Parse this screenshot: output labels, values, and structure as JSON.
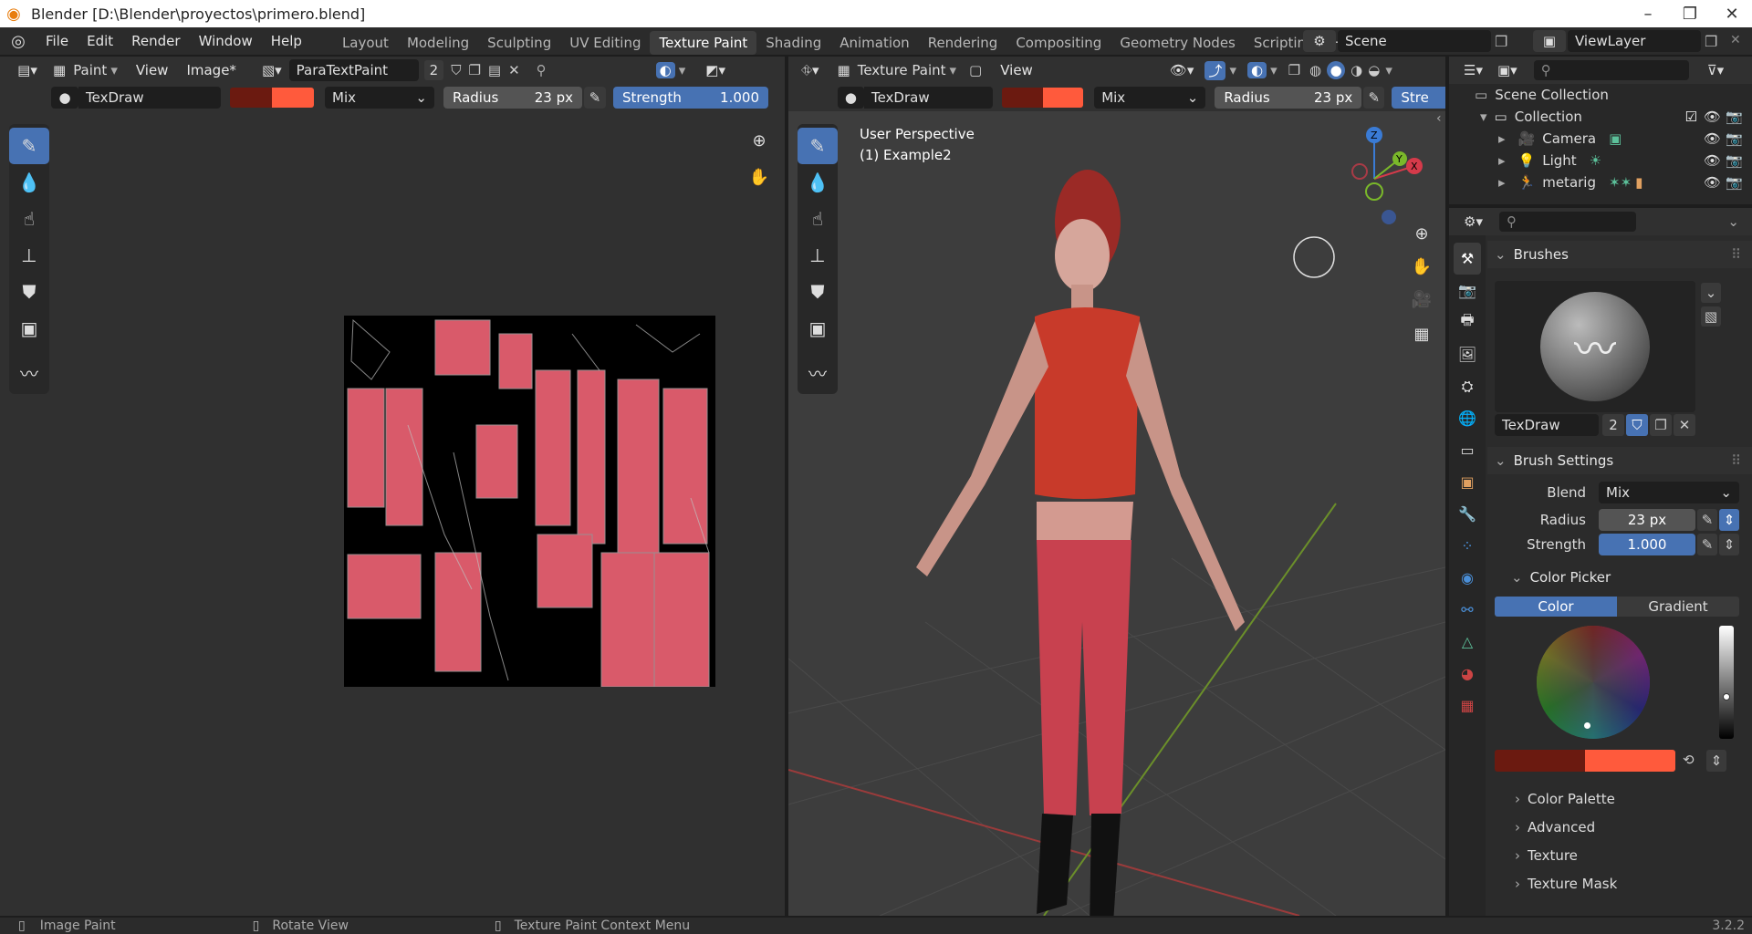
{
  "window": {
    "title": "Blender [D:\\Blender\\proyectos\\primero.blend]",
    "minimize": "–",
    "maximize": "❐",
    "close": "✕"
  },
  "menu": [
    "File",
    "Edit",
    "Render",
    "Window",
    "Help"
  ],
  "workspaces": [
    "Layout",
    "Modeling",
    "Sculpting",
    "UV Editing",
    "Texture Paint",
    "Shading",
    "Animation",
    "Rendering",
    "Compositing",
    "Geometry Nodes",
    "Scripting"
  ],
  "scene": {
    "name": "Scene",
    "view_layer": "ViewLayer"
  },
  "image_editor": {
    "mode": "Paint",
    "menus": [
      "View",
      "Image*"
    ],
    "image_name": "ParaTextPaint",
    "users": "2"
  },
  "viewport": {
    "mode": "Texture Paint",
    "menus": [
      "View"
    ],
    "perspective": "User Perspective",
    "object": "(1) Example2"
  },
  "tool_settings": {
    "brush": "TexDraw",
    "blend": "Mix",
    "radius_label": "Radius",
    "radius_value": "23 px",
    "strength_label": "Strength",
    "strength_value": "1.000",
    "strength_short": "Stre",
    "color_dark": "#6b1a10",
    "color_light": "#ff5a3c"
  },
  "outliner": {
    "scene_collection": "Scene Collection",
    "collection": "Collection",
    "items": [
      "Camera",
      "Light",
      "metarig"
    ]
  },
  "properties": {
    "brushes_title": "Brushes",
    "brush_name": "TexDraw",
    "brush_users": "2",
    "brush_settings_title": "Brush Settings",
    "blend_label": "Blend",
    "blend_value": "Mix",
    "radius_label": "Radius",
    "radius_value": "23 px",
    "strength_label": "Strength",
    "strength_value": "1.000",
    "color_picker_title": "Color Picker",
    "color_tab": "Color",
    "gradient_tab": "Gradient",
    "collapsed": [
      "Color Palette",
      "Advanced",
      "Texture",
      "Texture Mask"
    ]
  },
  "status": {
    "left": "Image Paint",
    "middle": "Rotate View",
    "right": "Texture Paint Context Menu",
    "version": "3.2.2"
  },
  "colors": {
    "accent": "#4772b3",
    "active_tab_bg": "#3d3d3d",
    "shirt": "#c83a2a",
    "pants": "#c8414f"
  }
}
